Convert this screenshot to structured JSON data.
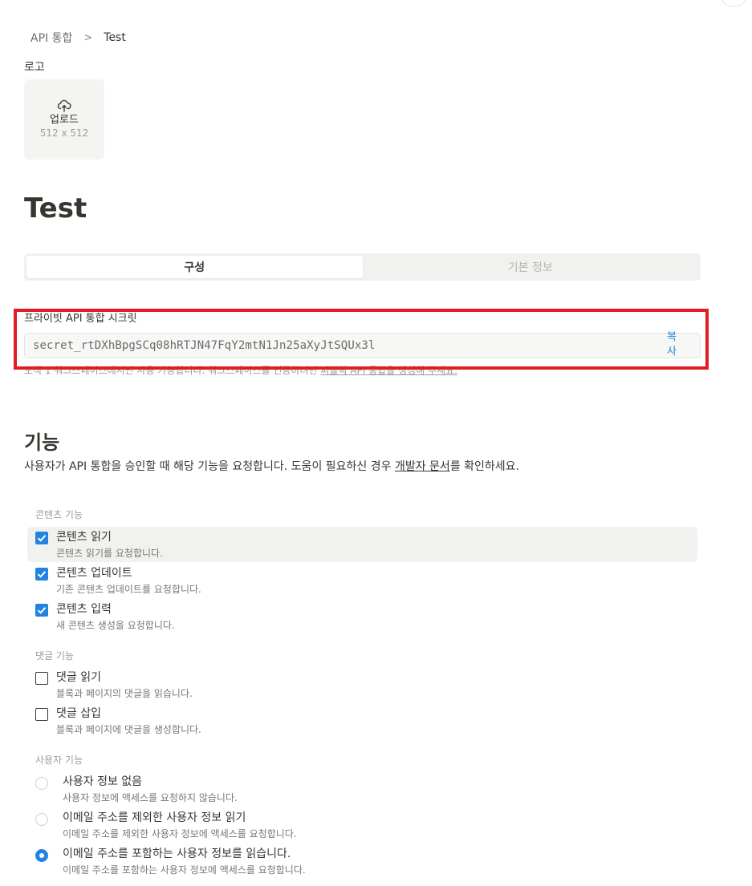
{
  "breadcrumb": {
    "parent": "API 통합",
    "separator": ">",
    "current": "Test"
  },
  "logo": {
    "label": "로고",
    "upload_label": "업로드",
    "size_hint": "512 x 512",
    "icon": "cloud-upload-icon"
  },
  "page_title": "Test",
  "tabs": [
    {
      "label": "구성",
      "active": true
    },
    {
      "label": "기본 정보",
      "active": false
    }
  ],
  "secret": {
    "label": "프라이빗 API 통합 시크릿",
    "value": "secret_rtDXhBpgSCq08hRTJN47FqY2mtN1Jn25aXyJtSQUx3l",
    "copy_label": "복사",
    "help_text": "오직 1 워크스페이스에서만 사용 가능합니다. 워크스페이스를 연동하려면 ",
    "help_link": "퍼블릭 API 통합을 생성해 주세요."
  },
  "capabilities": {
    "title": "기능",
    "description_prefix": "사용자가 API 통합을 승인할 때 해당 기능을 요청합니다. 도움이 필요하신 경우 ",
    "description_link": "개발자 문서",
    "description_suffix": "를 확인하세요.",
    "content_group": {
      "title": "콘텐츠 기능",
      "items": [
        {
          "title": "콘텐츠 읽기",
          "desc": "콘텐츠 읽기를 요청합니다.",
          "checked": true
        },
        {
          "title": "콘텐츠 업데이트",
          "desc": "기존 콘텐츠 업데이트를 요청합니다.",
          "checked": true
        },
        {
          "title": "콘텐츠 입력",
          "desc": "새 콘텐츠 생성을 요청합니다.",
          "checked": true
        }
      ]
    },
    "comment_group": {
      "title": "댓글 기능",
      "items": [
        {
          "title": "댓글 읽기",
          "desc": "블록과 페이지의 댓글을 읽습니다.",
          "checked": false
        },
        {
          "title": "댓글 삽입",
          "desc": "블록과 페이지에 댓글을 생성합니다.",
          "checked": false
        }
      ]
    },
    "user_group": {
      "title": "사용자 기능",
      "items": [
        {
          "title": "사용자 정보 없음",
          "desc": "사용자 정보에 액세스를 요청하지 않습니다.",
          "selected": false
        },
        {
          "title": "이메일 주소를 제외한 사용자 정보 읽기",
          "desc": "이메일 주소를 제외한 사용자 정보에 액세스를 요청합니다.",
          "selected": false
        },
        {
          "title": "이메일 주소를 포함하는 사용자 정보를 읽습니다.",
          "desc": "이메일 주소를 포함하는 사용자 정보에 액세스를 요청합니다.",
          "selected": true
        }
      ]
    }
  },
  "colors": {
    "accent": "#2383e2",
    "highlight": "#e11d24",
    "text": "#37352f",
    "muted": "#9b9a97"
  }
}
